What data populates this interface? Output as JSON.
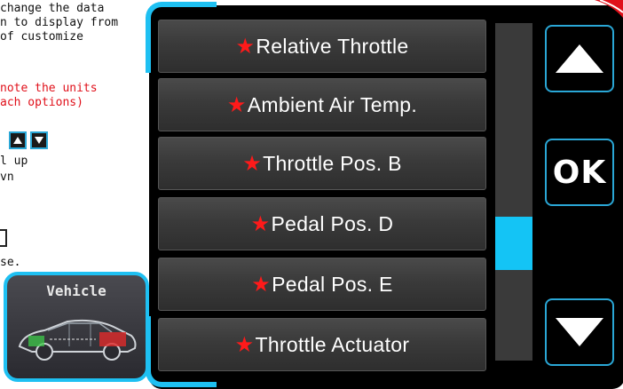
{
  "instructions": {
    "line1": "change the data",
    "line2": "n to display from",
    "line3": "of customize",
    "note1": "note the units",
    "note2": "ach options)",
    "scroll_up": "l up",
    "scroll_down": "vn",
    "close": "se."
  },
  "list": {
    "items": [
      {
        "label": "Relative Throttle"
      },
      {
        "label": "Ambient Air Temp."
      },
      {
        "label": "Throttle Pos. B"
      },
      {
        "label": "Pedal Pos. D"
      },
      {
        "label": "Pedal Pos. E"
      },
      {
        "label": "Throttle Actuator"
      }
    ],
    "star": "★"
  },
  "nav": {
    "up_icon": "up-arrow-icon",
    "ok_label": "OK",
    "down_icon": "down-arrow-icon"
  },
  "scrollbar": {
    "position_fraction": 0.62
  },
  "vehicle": {
    "label": "Vehicle",
    "icon": "car-icon"
  },
  "colors": {
    "accent": "#1ec0f2",
    "star": "#ff1a1a",
    "screen_bg": "#000000",
    "item_bg": "#3a3a3a"
  }
}
